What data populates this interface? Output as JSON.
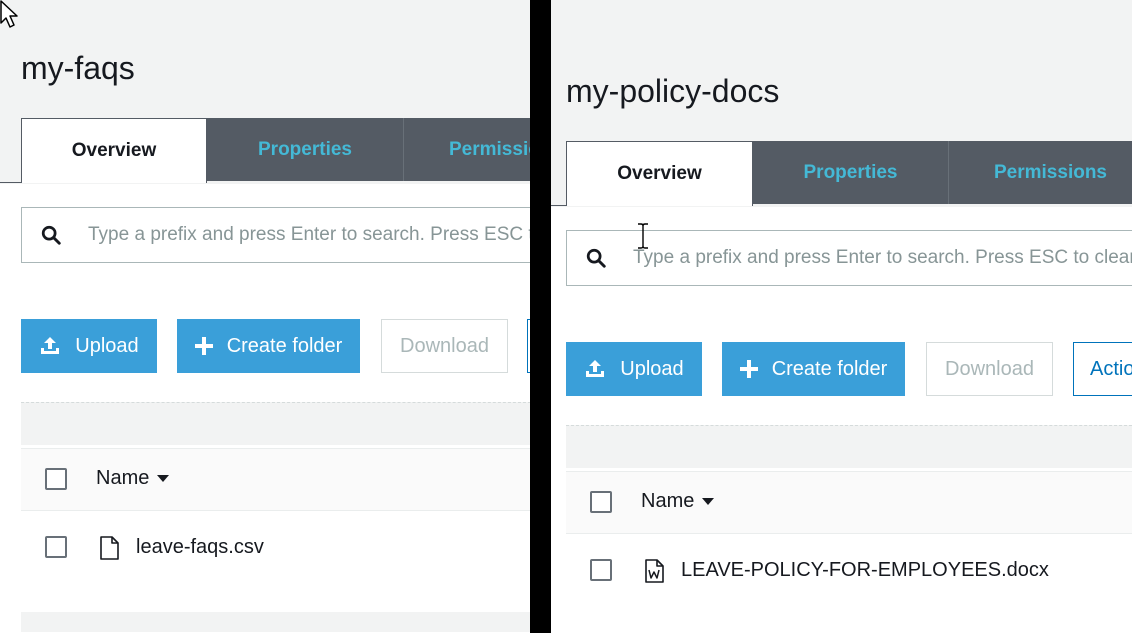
{
  "left": {
    "bucket_title": "my-faqs",
    "tabs": [
      {
        "label": "Overview",
        "active": true
      },
      {
        "label": "Properties",
        "active": false
      },
      {
        "label": "Permissions",
        "active": false
      }
    ],
    "search": {
      "placeholder": "Type a prefix and press Enter to search. Press ESC to clear."
    },
    "buttons": {
      "upload": "Upload",
      "create_folder": "Create folder",
      "download": "Download"
    },
    "table": {
      "header": {
        "name": "Name"
      },
      "rows": [
        {
          "name": "leave-faqs.csv",
          "icon": "file-icon"
        }
      ]
    }
  },
  "right": {
    "bucket_title": "my-policy-docs",
    "tabs": [
      {
        "label": "Overview",
        "active": true
      },
      {
        "label": "Properties",
        "active": false
      },
      {
        "label": "Permissions",
        "active": false
      }
    ],
    "search": {
      "placeholder": "Type a prefix and press Enter to search. Press ESC to clear."
    },
    "buttons": {
      "upload": "Upload",
      "create_folder": "Create folder",
      "download": "Download",
      "actions": "Actions"
    },
    "table": {
      "header": {
        "name": "Name"
      },
      "rows": [
        {
          "name": "LEAVE-POLICY-FOR-EMPLOYEES.docx",
          "icon": "word-document-icon"
        }
      ]
    }
  },
  "colors": {
    "tab_inactive_bg": "#545b64",
    "tab_inactive_text": "#44b9d6",
    "primary_button": "#3a9fd9",
    "actions_outline": "#0073bb"
  }
}
